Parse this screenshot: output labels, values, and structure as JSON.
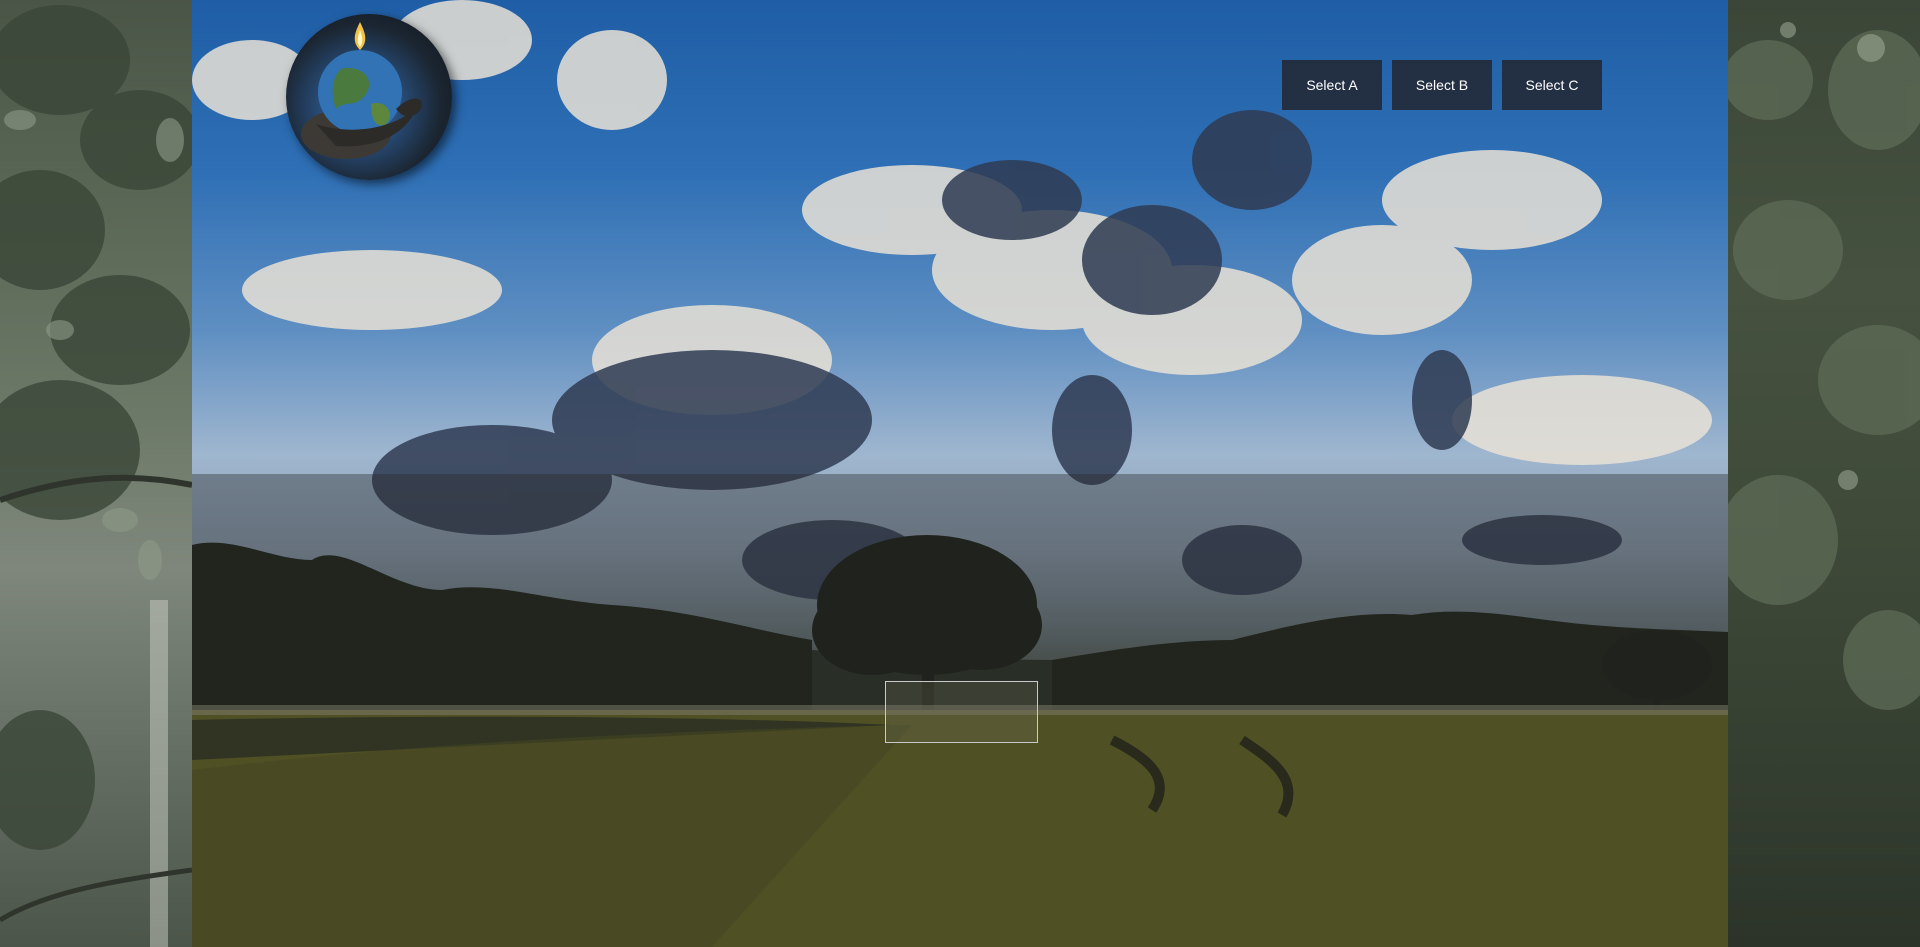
{
  "buttons": [
    {
      "label": "Select A"
    },
    {
      "label": "Select B"
    },
    {
      "label": "Select C"
    }
  ],
  "logo": {
    "icon": "globe-in-hands-icon"
  },
  "colors": {
    "button_bg": "#232a3a",
    "button_text": "#ffffff",
    "sky": "#2e6fb5",
    "field": "#6b6a22"
  }
}
